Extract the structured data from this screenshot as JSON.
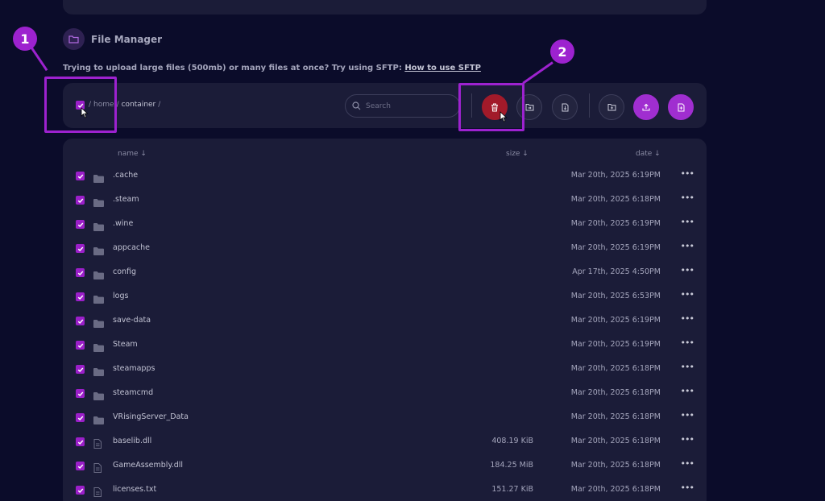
{
  "header": {
    "title": "File Manager"
  },
  "sftp": {
    "text": "Trying to upload large files (500mb) or many files at once? Try using SFTP: ",
    "link": "How to use SFTP"
  },
  "breadcrumb": {
    "sep1": "/",
    "home": "home",
    "sep2": "/",
    "current": "container",
    "sep3": "/"
  },
  "search": {
    "placeholder": "Search"
  },
  "columns": {
    "name": "name ↓",
    "size": "size ↓",
    "date": "date ↓"
  },
  "rows": [
    {
      "name": ".cache",
      "type": "folder",
      "size": "",
      "date": "Mar 20th, 2025 6:19PM"
    },
    {
      "name": ".steam",
      "type": "folder",
      "size": "",
      "date": "Mar 20th, 2025 6:18PM"
    },
    {
      "name": ".wine",
      "type": "folder",
      "size": "",
      "date": "Mar 20th, 2025 6:19PM"
    },
    {
      "name": "appcache",
      "type": "folder",
      "size": "",
      "date": "Mar 20th, 2025 6:19PM"
    },
    {
      "name": "config",
      "type": "folder",
      "size": "",
      "date": "Apr 17th, 2025 4:50PM"
    },
    {
      "name": "logs",
      "type": "folder",
      "size": "",
      "date": "Mar 20th, 2025 6:53PM"
    },
    {
      "name": "save-data",
      "type": "folder",
      "size": "",
      "date": "Mar 20th, 2025 6:19PM"
    },
    {
      "name": "Steam",
      "type": "folder",
      "size": "",
      "date": "Mar 20th, 2025 6:19PM"
    },
    {
      "name": "steamapps",
      "type": "folder",
      "size": "",
      "date": "Mar 20th, 2025 6:18PM"
    },
    {
      "name": "steamcmd",
      "type": "folder",
      "size": "",
      "date": "Mar 20th, 2025 6:18PM"
    },
    {
      "name": "VRisingServer_Data",
      "type": "folder",
      "size": "",
      "date": "Mar 20th, 2025 6:18PM"
    },
    {
      "name": "baselib.dll",
      "type": "file",
      "size": "408.19 KiB",
      "date": "Mar 20th, 2025 6:18PM"
    },
    {
      "name": "GameAssembly.dll",
      "type": "file",
      "size": "184.25 MiB",
      "date": "Mar 20th, 2025 6:18PM"
    },
    {
      "name": "licenses.txt",
      "type": "file",
      "size": "151.27 KiB",
      "date": "Mar 20th, 2025 6:18PM"
    }
  ],
  "annotations": {
    "step1": "1",
    "step2": "2"
  },
  "colors": {
    "accent": "#9d22cf",
    "danger": "#a21a2a",
    "background": "#0b0c2a",
    "card": "#1b1c38"
  }
}
